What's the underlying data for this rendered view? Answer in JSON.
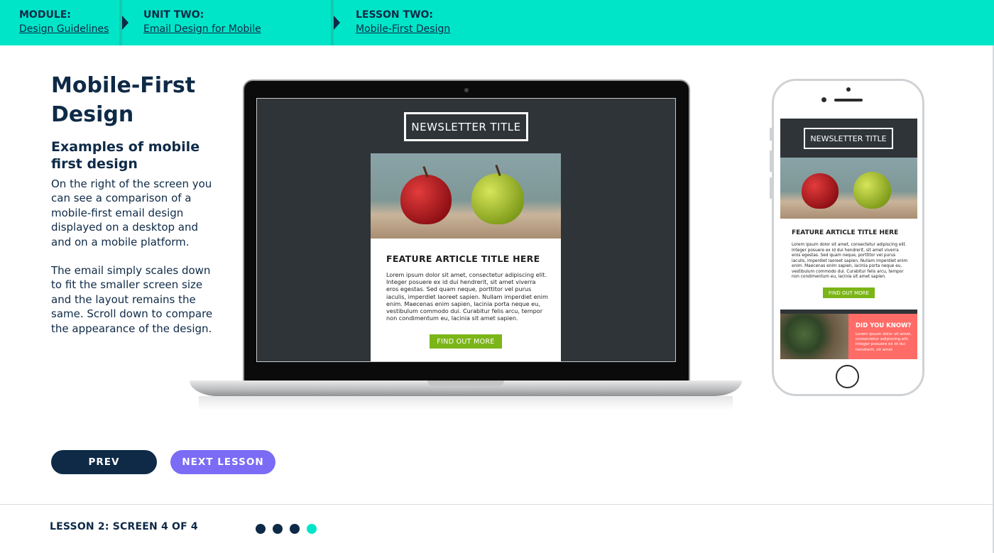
{
  "breadcrumb": {
    "module": {
      "label": "MODULE:",
      "link": "Design Guidelines"
    },
    "unit": {
      "label": "UNIT TWO:",
      "link": "Email Design for Mobile"
    },
    "lesson": {
      "label": "LESSON TWO:",
      "link": "Mobile-First Design"
    }
  },
  "content": {
    "title": "Mobile-First Design",
    "subtitle": "Examples of mobile first design",
    "paragraph1": "On the right of the screen you can see a comparison of a mobile-first email design displayed on a desktop and and on a mobile platform.",
    "paragraph2": "The email simply scales down to fit the smaller screen size and the layout remains the same. Scroll down to compare the appearance of the design."
  },
  "newsletter": {
    "title": "NEWSLETTER TITLE",
    "feature_title": "FEATURE ARTICLE TITLE HERE",
    "lorem": "Lorem ipsum dolor sit amet, consectetur adipiscing elit. Integer posuere ex id dui hendrerit, sit amet viverra eros egestas. Sed quam neque, porttitor vel purus iaculis, imperdiet laoreet sapien. Nullam imperdiet enim enim. Maecenas enim sapien, lacinia porta neque eu, vestibulum commodo dui. Curabitur felis arcu, tempor non condimentum eu, lacinia sit amet sapien.",
    "cta": "FIND OUT MORE",
    "did_you_know_title": "DID YOU KNOW?",
    "did_you_know_text": "Lorem ipsum dolor sit amet, consectetur adipiscing elit. Integer posuere ex id dui hendrerit, sit amet"
  },
  "nav": {
    "prev": "PREV",
    "next": "NEXT LESSON"
  },
  "footer": {
    "label": "LESSON 2: SCREEN 4 OF 4",
    "current_screen": 4,
    "total_screens": 4
  },
  "colors": {
    "accent": "#00e5c8",
    "navy": "#0e2a47",
    "next_button": "#7b6cf6",
    "cta_green": "#7cb518",
    "callout_red": "#ff6b66"
  }
}
